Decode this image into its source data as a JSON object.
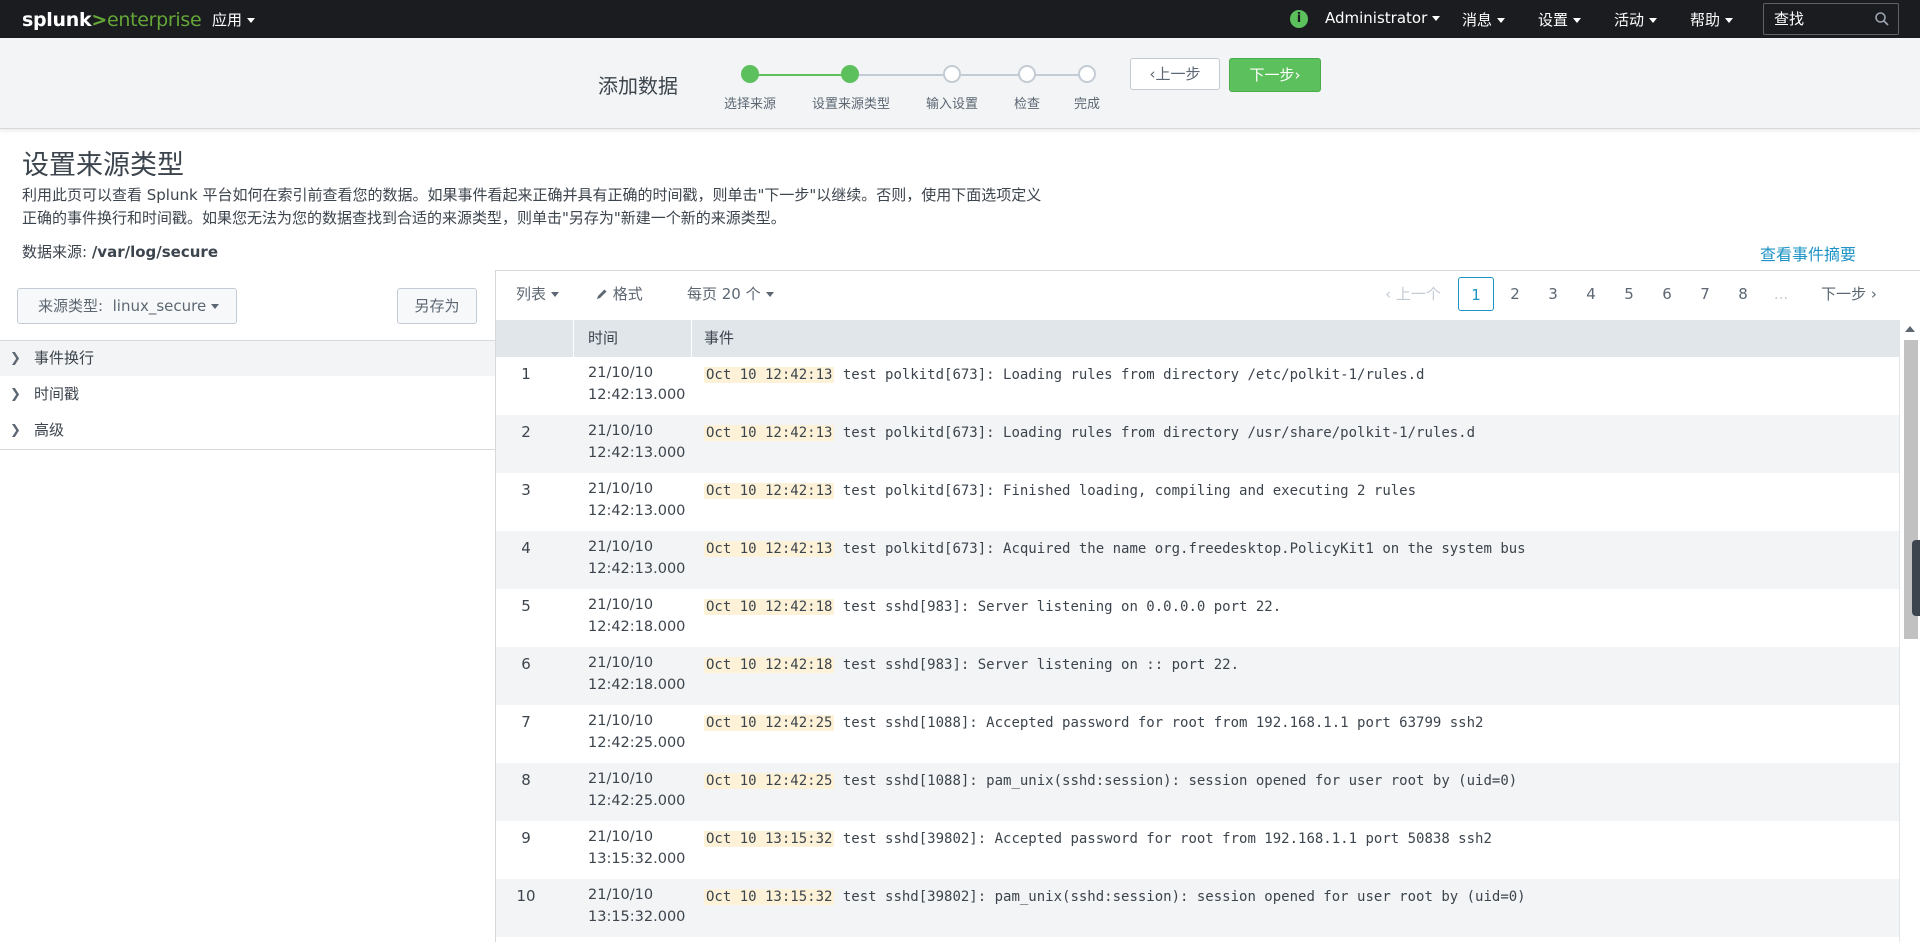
{
  "topbar": {
    "logo_splunk": "splunk",
    "logo_gt": ">",
    "logo_enterprise": "enterprise",
    "apps_label": "应用",
    "user_label": "Administrator",
    "messages_label": "消息",
    "settings_label": "设置",
    "activity_label": "活动",
    "help_label": "帮助",
    "search_placeholder": "查找",
    "info_icon_glyph": "i"
  },
  "wizard": {
    "title": "添加数据",
    "steps": [
      {
        "label": "选择来源",
        "status": "done"
      },
      {
        "label": "设置来源类型",
        "status": "current"
      },
      {
        "label": "输入设置",
        "status": "todo"
      },
      {
        "label": "检查",
        "status": "todo"
      },
      {
        "label": "完成",
        "status": "todo"
      }
    ],
    "prev_label": "上一步",
    "next_label": "下一步",
    "accent_color": "#5cc05c"
  },
  "page": {
    "title": "设置来源类型",
    "description": "利用此页可以查看 Splunk 平台如何在索引前查看您的数据。如果事件看起来正确并具有正确的时间戳，则单击\"下一步\"以继续。否则，使用下面选项定义正确的事件换行和时间戳。如果您无法为您的数据查找到合适的来源类型，则单击\"另存为\"新建一个新的来源类型。",
    "source_label": "数据来源: ",
    "source_value": "/var/log/secure",
    "summary_link": "查看事件摘要"
  },
  "left_panel": {
    "sourcetype_label": "来源类型:",
    "sourcetype_value": "linux_secure",
    "save_as_label": "另存为",
    "sections": [
      "事件换行",
      "时间戳",
      "高级"
    ]
  },
  "toolbar": {
    "list_label": "列表",
    "format_label": "格式",
    "per_page_label": "每页 20 个",
    "prev_page_label": "上一个",
    "next_page_label": "下一步",
    "pages": [
      "1",
      "2",
      "3",
      "4",
      "5",
      "6",
      "7",
      "8"
    ],
    "ellipsis": "...",
    "current_page": "1"
  },
  "table": {
    "col_time": "时间",
    "col_event": "事件",
    "rows": [
      {
        "num": "1",
        "date": "21/10/10",
        "time": "12:42:13.000",
        "ts": "Oct 10 12:42:13",
        "msg": "test polkitd[673]: Loading rules from directory /etc/polkit-1/rules.d"
      },
      {
        "num": "2",
        "date": "21/10/10",
        "time": "12:42:13.000",
        "ts": "Oct 10 12:42:13",
        "msg": "test polkitd[673]: Loading rules from directory /usr/share/polkit-1/rules.d"
      },
      {
        "num": "3",
        "date": "21/10/10",
        "time": "12:42:13.000",
        "ts": "Oct 10 12:42:13",
        "msg": "test polkitd[673]: Finished loading, compiling and executing 2 rules"
      },
      {
        "num": "4",
        "date": "21/10/10",
        "time": "12:42:13.000",
        "ts": "Oct 10 12:42:13",
        "msg": "test polkitd[673]: Acquired the name org.freedesktop.PolicyKit1 on the system bus"
      },
      {
        "num": "5",
        "date": "21/10/10",
        "time": "12:42:18.000",
        "ts": "Oct 10 12:42:18",
        "msg": "test sshd[983]: Server listening on 0.0.0.0 port 22."
      },
      {
        "num": "6",
        "date": "21/10/10",
        "time": "12:42:18.000",
        "ts": "Oct 10 12:42:18",
        "msg": "test sshd[983]: Server listening on :: port 22."
      },
      {
        "num": "7",
        "date": "21/10/10",
        "time": "12:42:25.000",
        "ts": "Oct 10 12:42:25",
        "msg": "test sshd[1088]: Accepted password for root from 192.168.1.1 port 63799 ssh2"
      },
      {
        "num": "8",
        "date": "21/10/10",
        "time": "12:42:25.000",
        "ts": "Oct 10 12:42:25",
        "msg": "test sshd[1088]: pam_unix(sshd:session): session opened for user root by (uid=0)"
      },
      {
        "num": "9",
        "date": "21/10/10",
        "time": "13:15:32.000",
        "ts": "Oct 10 13:15:32",
        "msg": "test sshd[39802]: Accepted password for root from 192.168.1.1 port 50838 ssh2"
      },
      {
        "num": "10",
        "date": "21/10/10",
        "time": "13:15:32.000",
        "ts": "Oct 10 13:15:32",
        "msg": "test sshd[39802]: pam_unix(sshd:session): session opened for user root by (uid=0)"
      }
    ]
  }
}
